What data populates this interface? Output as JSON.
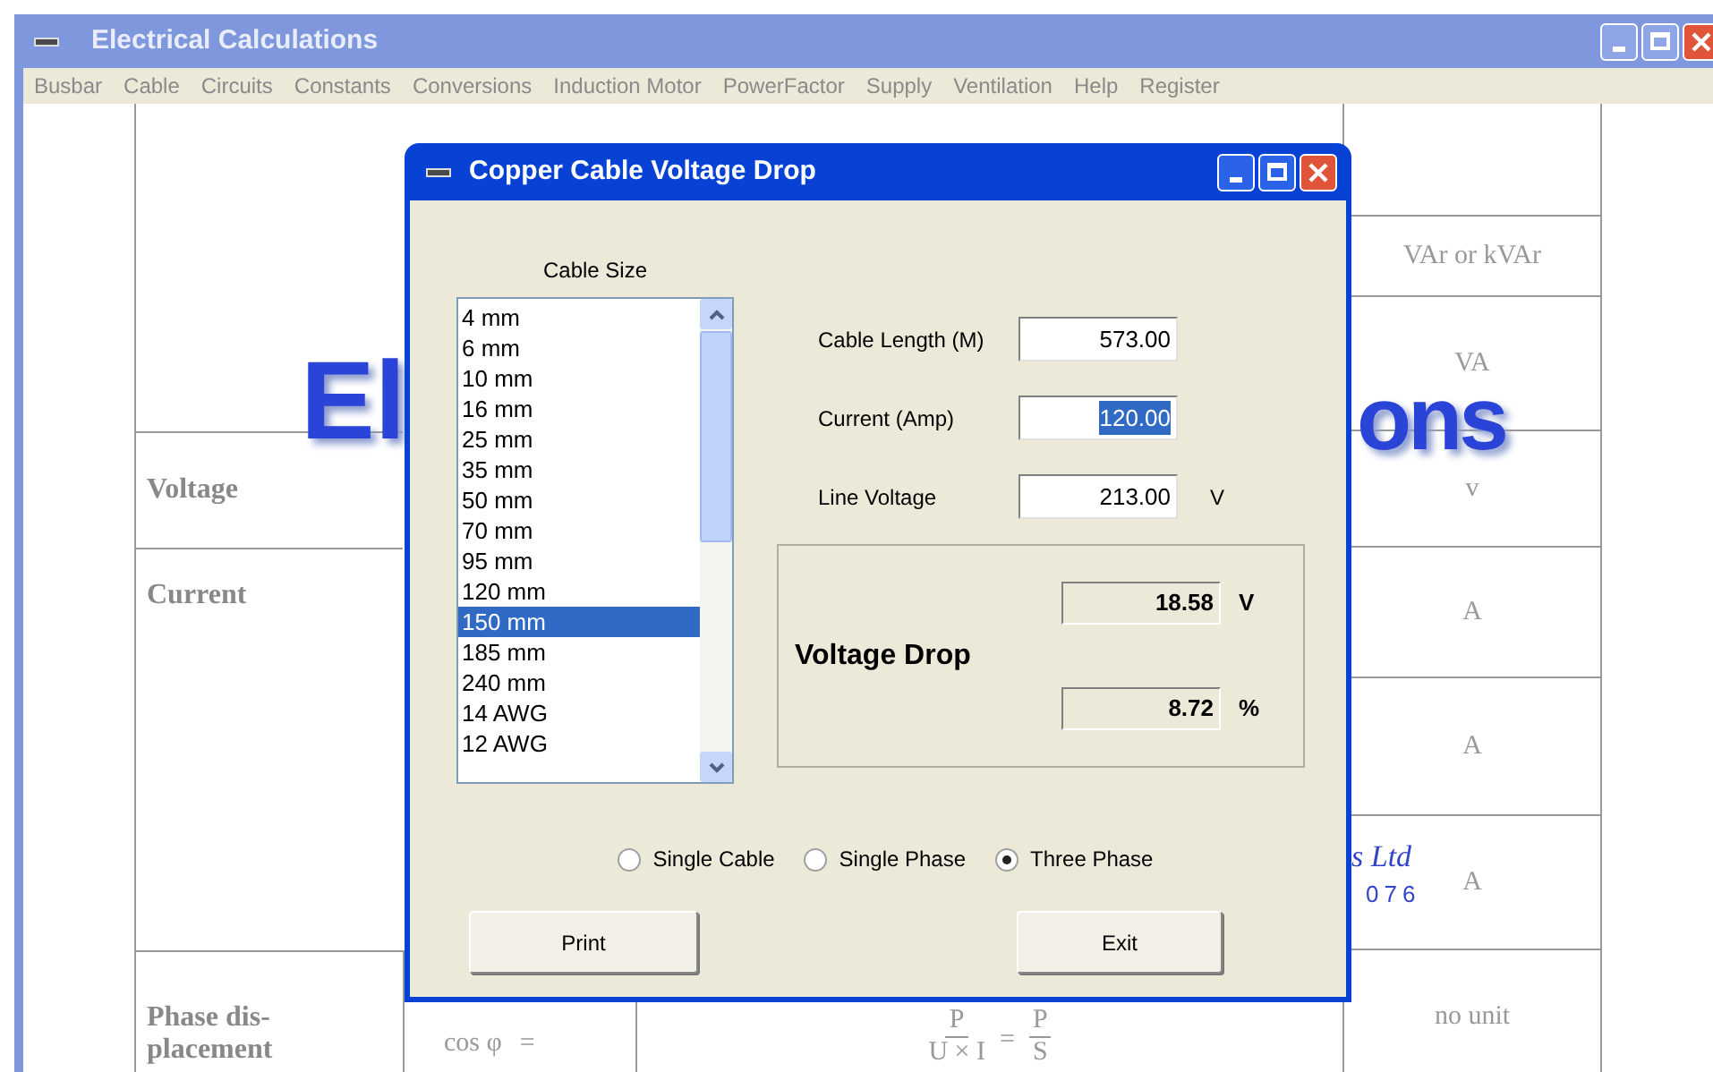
{
  "main_window": {
    "title": "Electrical Calculations"
  },
  "menu": [
    "Busbar",
    "Cable",
    "Circuits",
    "Constants",
    "Conversions",
    "Induction Motor",
    "PowerFactor",
    "Supply",
    "Ventilation",
    "Help",
    "Register"
  ],
  "document": {
    "logo_left": "El",
    "logo_right": "ons",
    "company_tail": "s Ltd",
    "phone_tail": "076",
    "unit_cells": [
      "VAr or kVAr",
      "VA",
      "v",
      "A",
      "A",
      "A"
    ],
    "row_labels": [
      "Voltage",
      "Current"
    ],
    "bottom_row": {
      "label_lines": [
        "Phase dis-",
        "placement"
      ],
      "symbol": "cos φ",
      "symbol_equals": "=",
      "formula": {
        "numerator_1": "P",
        "denominator_1": "U × I",
        "equals": "=",
        "numerator_2": "P",
        "denominator_2": "S"
      },
      "unit": "no unit"
    }
  },
  "dialog": {
    "title": "Copper Cable Voltage Drop",
    "list_label": "Cable Size",
    "cable_sizes": [
      {
        "label": "4 mm",
        "selected": false
      },
      {
        "label": "6 mm",
        "selected": false
      },
      {
        "label": "10 mm",
        "selected": false
      },
      {
        "label": "16 mm",
        "selected": false
      },
      {
        "label": "25 mm",
        "selected": false
      },
      {
        "label": "35 mm",
        "selected": false
      },
      {
        "label": "50 mm",
        "selected": false
      },
      {
        "label": "70 mm",
        "selected": false
      },
      {
        "label": "95 mm",
        "selected": false
      },
      {
        "label": "120 mm",
        "selected": false
      },
      {
        "label": "150 mm",
        "selected": true
      },
      {
        "label": "185 mm",
        "selected": false
      },
      {
        "label": "240 mm",
        "selected": false
      },
      {
        "label": "14 AWG",
        "selected": false
      },
      {
        "label": "12 AWG",
        "selected": false
      }
    ],
    "fields": [
      {
        "label": "Cable Length (M)",
        "value": "573.00",
        "highlighted": false
      },
      {
        "label": "Current (Amp)",
        "value": "120.00",
        "highlighted": true
      },
      {
        "label": "Line Voltage",
        "value": "213.00",
        "highlighted": false,
        "unit": "V"
      }
    ],
    "result": {
      "label": "Voltage Drop",
      "outputs": [
        {
          "value": "18.58",
          "unit": "V"
        },
        {
          "value": "8.72",
          "unit": "%"
        }
      ]
    },
    "radios": [
      {
        "label": "Single Cable",
        "selected": false
      },
      {
        "label": "Single Phase",
        "selected": false
      },
      {
        "label": "Three Phase",
        "selected": true
      }
    ],
    "buttons": [
      "Print",
      "Exit"
    ]
  }
}
